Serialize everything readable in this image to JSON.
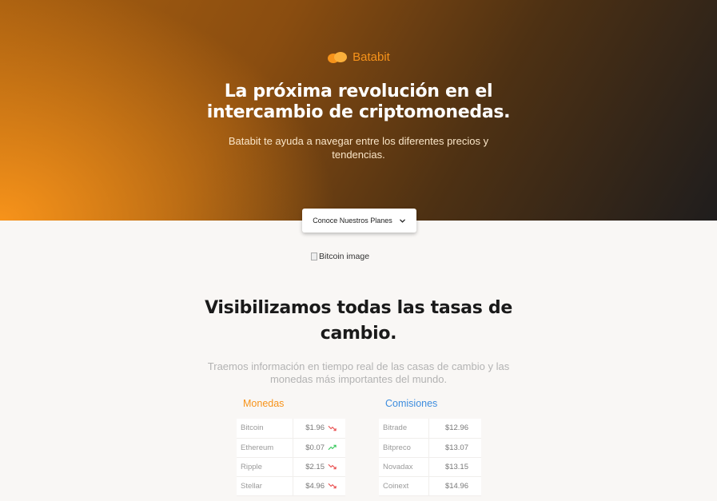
{
  "brand": {
    "name": "Batabit",
    "logo_icon": "bitcoin-logo-icon",
    "accent": "#f7931a"
  },
  "hero": {
    "title_line1": "La próxima revolución en el",
    "title_line2": "intercambio de criptomonedas.",
    "subtitle": "Batabit te ayuda a navegar entre los diferentes precios y tendencias.",
    "cta_label": "Conoce Nuestros Planes",
    "cta_icon": "chevron-down-icon"
  },
  "image": {
    "alt": "Bitcoin image"
  },
  "rates": {
    "title_line1": "Visibilizamos todas las tasas de",
    "title_line2": "cambio.",
    "subtitle": "Traemos información en tiempo real de las casas de cambio y las monedas más importantes del mundo.",
    "coins_title": "Monedas",
    "commissions_title": "Comisiones",
    "coins": [
      {
        "name": "Bitcoin",
        "price": "$1.96",
        "trend": "down"
      },
      {
        "name": "Ethereum",
        "price": "$0.07",
        "trend": "up"
      },
      {
        "name": "Ripple",
        "price": "$2.15",
        "trend": "down"
      },
      {
        "name": "Stellar",
        "price": "$4.96",
        "trend": "down"
      }
    ],
    "commissions": [
      {
        "name": "Bitrade",
        "price": "$12.96"
      },
      {
        "name": "Bitpreco",
        "price": "$13.07"
      },
      {
        "name": "Novadax",
        "price": "$13.15"
      },
      {
        "name": "Coinext",
        "price": "$14.96"
      }
    ],
    "colors": {
      "down": "#e94b4b",
      "up": "#34c759",
      "coins_title": "#f7931a",
      "commissions_title": "#3e8dde"
    }
  }
}
